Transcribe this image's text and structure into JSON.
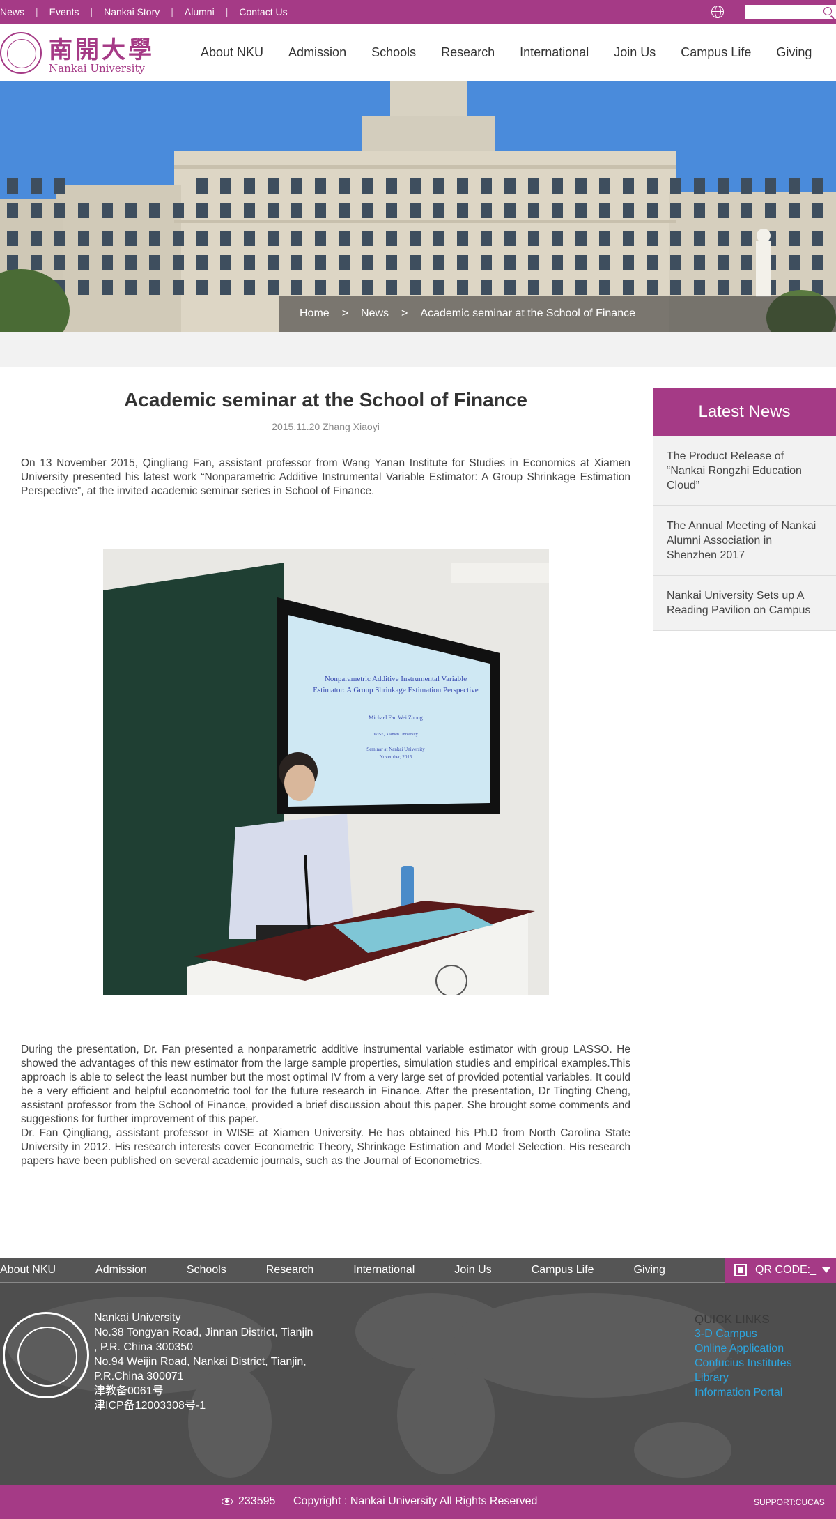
{
  "topbar": {
    "links": [
      "News",
      "Events",
      "Nankai Story",
      "Alumni",
      "Contact Us"
    ],
    "search_placeholder": ""
  },
  "header": {
    "logo_cn": "南開大學",
    "logo_en": "Nankai University",
    "nav": [
      "About NKU",
      "Admission",
      "Schools",
      "Research",
      "International",
      "Join Us",
      "Campus Life",
      "Giving"
    ]
  },
  "breadcrumb": [
    "Home",
    ">",
    "News",
    ">",
    "Academic seminar at the School of Finance"
  ],
  "article": {
    "title": "Academic seminar at the School of Finance",
    "meta": "2015.11.20 Zhang Xiaoyi",
    "intro": "On 13 November 2015, Qingliang Fan, assistant professor from Wang Yanan Institute for Studies in Economics at Xiamen University presented his latest work “Nonparametric Additive Instrumental Variable Estimator: A Group Shrinkage Estimation Perspective”, at the invited academic seminar series in School of Finance.",
    "slide": {
      "title_line1": "Nonparametric Additive Instrumental Variable",
      "title_line2": "Estimator: A Group Shrinkage Estimation Perspective",
      "authors": "Michael Fan          Wei Zhong",
      "affil": "WISE, Xiamen University",
      "venue": "Seminar at Nankai University",
      "date": "November, 2015"
    },
    "body1": "During the presentation, Dr. Fan presented a nonparametric additive instrumental variable estimator with group LASSO. He showed the advantages of this new estimator from the large sample properties, simulation studies and empirical examples.This approach is able to select the least number but the most optimal IV from a very large set of provided potential variables. It could be a very efficient and helpful econometric tool for the future research in Finance. After the presentation, Dr Tingting Cheng, assistant professor from the School of Finance, provided a brief discussion about this paper. She brought some comments and suggestions for further improvement of this paper.",
    "body2": "Dr. Fan Qingliang, assistant professor in WISE at Xiamen University. He has obtained his Ph.D from North Carolina State University in 2012. His research interests cover Econometric Theory, Shrinkage Estimation and Model Selection. His research papers have been published on several academic journals, such as the Journal of Econometrics."
  },
  "sidebar": {
    "title": "Latest News",
    "items": [
      "The Product Release of “Nankai Rongzhi Education Cloud”",
      "The Annual Meeting of Nankai Alumni Association in Shenzhen 2017",
      "Nankai University Sets up A Reading Pavilion on Campus"
    ]
  },
  "footer_nav": {
    "items": [
      "About NKU",
      "Admission",
      "Schools",
      "Research",
      "International",
      "Join Us",
      "Campus Life",
      "Giving"
    ],
    "qr_label": "QR CODE:_"
  },
  "footer": {
    "address_lines": [
      "Nankai University",
      "No.38 Tongyan Road, Jinnan District, Tianjin",
      ", P.R. China 300350",
      "No.94 Weijin Road,  Nankai District, Tianjin,",
      "P.R.China  300071",
      "津教备0061号",
      "津ICP备12003308号-1"
    ],
    "quick_title": "QUICK LINKS",
    "quick_links": [
      "3-D Campus",
      "Online Application",
      "Confucius Institutes",
      "Library",
      "Information Portal"
    ]
  },
  "bottombar": {
    "visits": "233595",
    "copyright": "Copyright : Nankai University All Rights Reserved",
    "support": "SUPPORT:CUCAS"
  },
  "colors": {
    "brand": "#a53a86",
    "footer_bg": "#4e4e4e",
    "link_blue": "#2ca6e0"
  }
}
